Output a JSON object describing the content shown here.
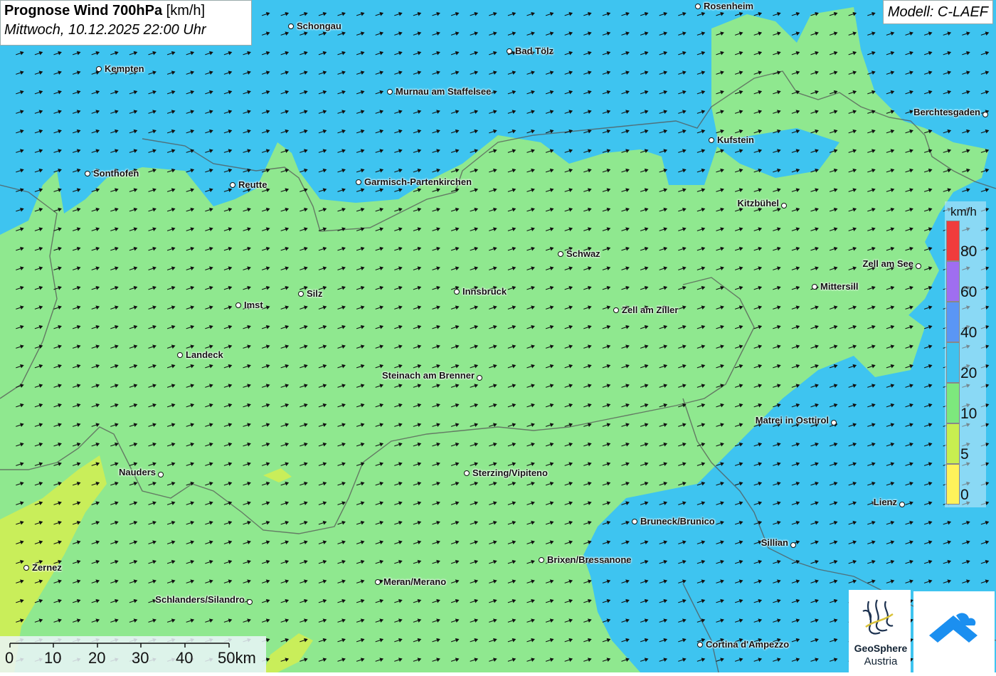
{
  "title": {
    "main": "Prognose Wind 700hPa",
    "unit": "[km/h]",
    "datetime": "Mittwoch, 10.12.2025 22:00 Uhr"
  },
  "model": "Modell: C-LAEF",
  "legend": {
    "unit": "km/h",
    "ticks": [
      "80",
      "60",
      "40",
      "20",
      "10",
      "5",
      "0"
    ],
    "colors": [
      "#f03c3c",
      "#9f6ef0",
      "#5a96f5",
      "#3fc2ef",
      "#7de87d",
      "#c8ee50",
      "#fff25a"
    ]
  },
  "scalebar": {
    "labels": [
      "0",
      "10",
      "20",
      "30",
      "40",
      "50km"
    ]
  },
  "cities": [
    {
      "name": "Rosenheim"
    },
    {
      "name": "Schongau"
    },
    {
      "name": "Bad Tölz"
    },
    {
      "name": "Kempten"
    },
    {
      "name": "Murnau am Staffelsee"
    },
    {
      "name": "Berchtesgaden"
    },
    {
      "name": "Kufstein"
    },
    {
      "name": "Sonthofen"
    },
    {
      "name": "Reutte"
    },
    {
      "name": "Garmisch-Partenkirchen"
    },
    {
      "name": "Kitzbühel"
    },
    {
      "name": "Schwaz"
    },
    {
      "name": "Zell am See"
    },
    {
      "name": "Silz"
    },
    {
      "name": "Innsbruck"
    },
    {
      "name": "Mittersill"
    },
    {
      "name": "Imst"
    },
    {
      "name": "Zell am Ziller"
    },
    {
      "name": "Landeck"
    },
    {
      "name": "Steinach am Brenner"
    },
    {
      "name": "Matrei in Osttirol"
    },
    {
      "name": "Nauders"
    },
    {
      "name": "Sterzing/Vipiteno"
    },
    {
      "name": "Lienz"
    },
    {
      "name": "Bruneck/Brunico"
    },
    {
      "name": "Sillian"
    },
    {
      "name": "Zernez"
    },
    {
      "name": "Brixen/Bressanone"
    },
    {
      "name": "Meran/Merano"
    },
    {
      "name": "Schlanders/Silandro"
    },
    {
      "name": "Cortina d'Ampezzo"
    }
  ],
  "logos": {
    "geosphere_line1": "GeoSphere",
    "geosphere_line2": "Austria"
  },
  "colors": {
    "wind_10_20": "#8fe88f",
    "wind_20_40": "#3ec4f0",
    "wind_5_10": "#c9ee5a"
  }
}
